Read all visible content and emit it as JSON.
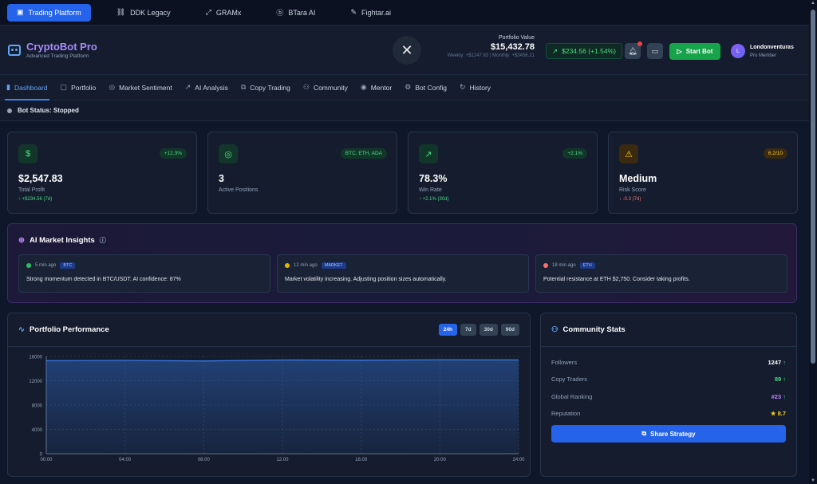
{
  "top_tabs": [
    {
      "label": "Trading Platform",
      "icon": "robot-icon"
    },
    {
      "label": "DDK Legacy",
      "icon": "link-icon"
    },
    {
      "label": "GRAMx",
      "icon": "expand-icon"
    },
    {
      "label": "BTara AI",
      "icon": "bitcoin-icon"
    },
    {
      "label": "Fightar.ai",
      "icon": "pen-icon"
    }
  ],
  "brand": {
    "name": "CryptoBot Pro",
    "subtitle": "Advanced Trading Platform"
  },
  "portfolio": {
    "label": "Portfolio Value",
    "value": "$15,432.78",
    "sub": "Weekly: +$1247.83 | Monthly: +$3456.21"
  },
  "change": "$234.56 (+1.54%)",
  "start_button": "Start Bot",
  "user": {
    "initial": "L",
    "name": "Londonventuras",
    "role": "Pro Member"
  },
  "nav": [
    "Dashboard",
    "Portfolio",
    "Market Sentiment",
    "AI Analysis",
    "Copy Trading",
    "Community",
    "Mentor",
    "Bot Config",
    "History"
  ],
  "bot_status": "Bot Status: Stopped",
  "cards": [
    {
      "icon": "$",
      "badge": "+12.3%",
      "value": "$2,547.83",
      "label": "Total Profit",
      "sub": "↑ +$234.56 (7d)"
    },
    {
      "icon": "◎",
      "badge": "BTC, ETH, ADA",
      "value": "3",
      "label": "Active Positions",
      "sub": ""
    },
    {
      "icon": "↗",
      "badge": "+2.1%",
      "value": "78.3%",
      "label": "Win Rate",
      "sub": "↑ +2.1% (30d)"
    },
    {
      "icon": "⚠",
      "badge": "6.2/10",
      "value": "Medium",
      "label": "Risk Score",
      "sub": "↓ -0.3 (7d)"
    }
  ],
  "insights": {
    "title": "AI Market Insights",
    "items": [
      {
        "time": "5 min ago",
        "tag": "BTC",
        "dot": "#22c55e",
        "msg": "Strong momentum detected in BTC/USDT. AI confidence: 87%"
      },
      {
        "time": "12 min ago",
        "tag": "MARKET",
        "dot": "#eab308",
        "msg": "Market volatility increasing. Adjusting position sizes automatically."
      },
      {
        "time": "18 min ago",
        "tag": "ETH",
        "dot": "#f87171",
        "msg": "Potential resistance at ETH $2,750. Consider taking profits."
      }
    ]
  },
  "performance": {
    "title": "Portfolio Performance",
    "ranges": [
      "24h",
      "7d",
      "30d",
      "90d"
    ],
    "active_range": "24h"
  },
  "chart_data": {
    "type": "area",
    "x": [
      "00:00",
      "04:00",
      "08:00",
      "12:00",
      "16:00",
      "20:00",
      "24:00"
    ],
    "values": [
      15300,
      15350,
      15250,
      15420,
      15380,
      15450,
      15432.78
    ],
    "ylim": [
      0,
      16000
    ],
    "yticks": [
      0,
      4000,
      8000,
      12000,
      16000
    ],
    "grid": true,
    "color": "#3b82f6"
  },
  "community": {
    "title": "Community Stats",
    "rows": [
      {
        "label": "Followers",
        "value": "1247",
        "color": "#ffffff",
        "trend": "↑"
      },
      {
        "label": "Copy Traders",
        "value": "89",
        "color": "#4ade80",
        "trend": "↑"
      },
      {
        "label": "Global Ranking",
        "value": "#23",
        "color": "#c084fc",
        "trend": "↑"
      },
      {
        "label": "Reputation",
        "value": "★ 8.7",
        "color": "#facc15",
        "trend": ""
      }
    ],
    "share_button": "Share Strategy"
  }
}
